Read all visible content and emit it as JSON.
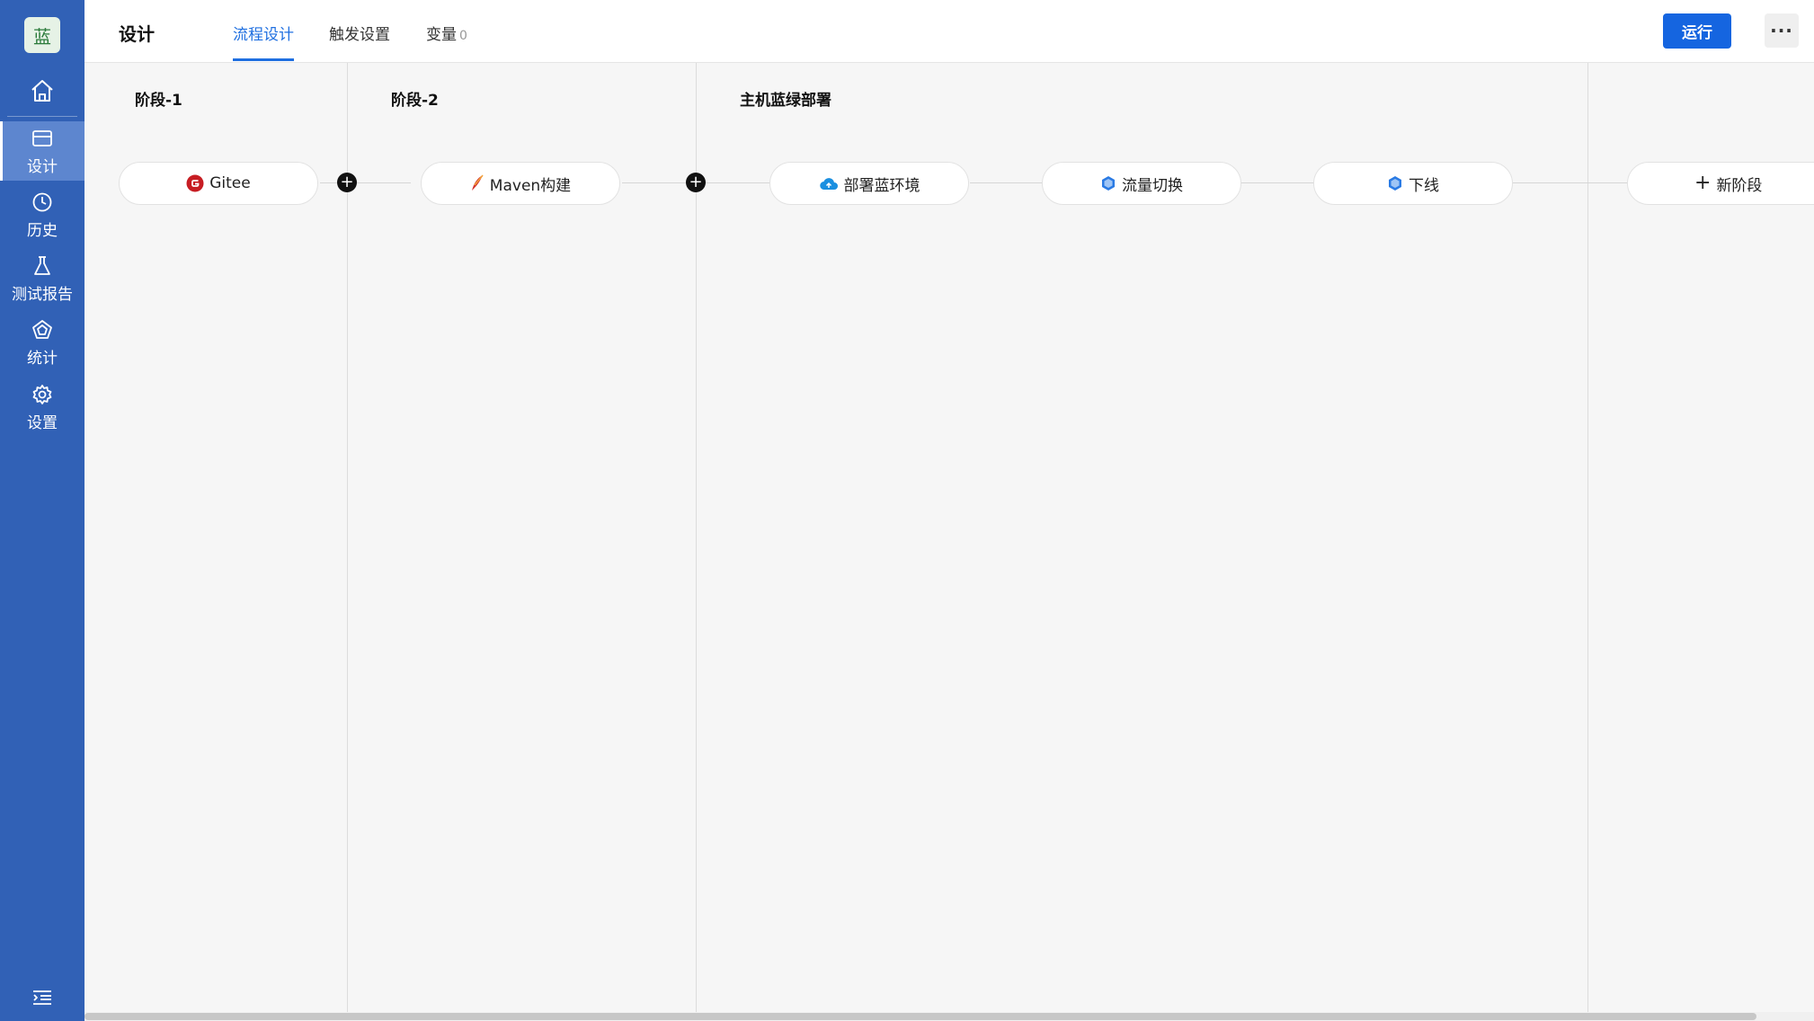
{
  "sidebar": {
    "avatar_text": "蓝",
    "home_icon": "home-icon",
    "items": [
      {
        "label": "设计",
        "icon": "design-card-icon",
        "active": true
      },
      {
        "label": "历史",
        "icon": "clock-icon",
        "active": false
      },
      {
        "label": "测试报告",
        "icon": "flask-icon",
        "active": false
      },
      {
        "label": "统计",
        "icon": "stats-pentagon-icon",
        "active": false
      },
      {
        "label": "设置",
        "icon": "gear-icon",
        "active": false
      }
    ],
    "collapse_icon": "menu-collapse-icon"
  },
  "header": {
    "title": "设计",
    "tabs": [
      {
        "label": "流程设计",
        "active": true
      },
      {
        "label": "触发设置",
        "active": false
      },
      {
        "label": "变量",
        "count": "0",
        "active": false
      }
    ],
    "run_label": "运行",
    "more_label": "···"
  },
  "stages": [
    {
      "title": "阶段-1",
      "tasks": [
        {
          "label": "Gitee",
          "icon": "gitee-icon"
        }
      ]
    },
    {
      "title": "阶段-2",
      "tasks": [
        {
          "label": "Maven构建",
          "icon": "maven-feather-icon"
        }
      ]
    },
    {
      "title": "主机蓝绿部署",
      "tasks": [
        {
          "label": "部署蓝环境",
          "icon": "cloud-icon"
        },
        {
          "label": "流量切换",
          "icon": "cube-icon"
        },
        {
          "label": "下线",
          "icon": "cube-icon"
        }
      ]
    }
  ],
  "new_stage_label": "新阶段",
  "colors": {
    "sidebar_bg": "#3161b6",
    "sidebar_active": "#5d86cf",
    "accent": "#1f6fe0",
    "run_button": "#1565e0",
    "canvas_bg": "#f6f6f6"
  }
}
